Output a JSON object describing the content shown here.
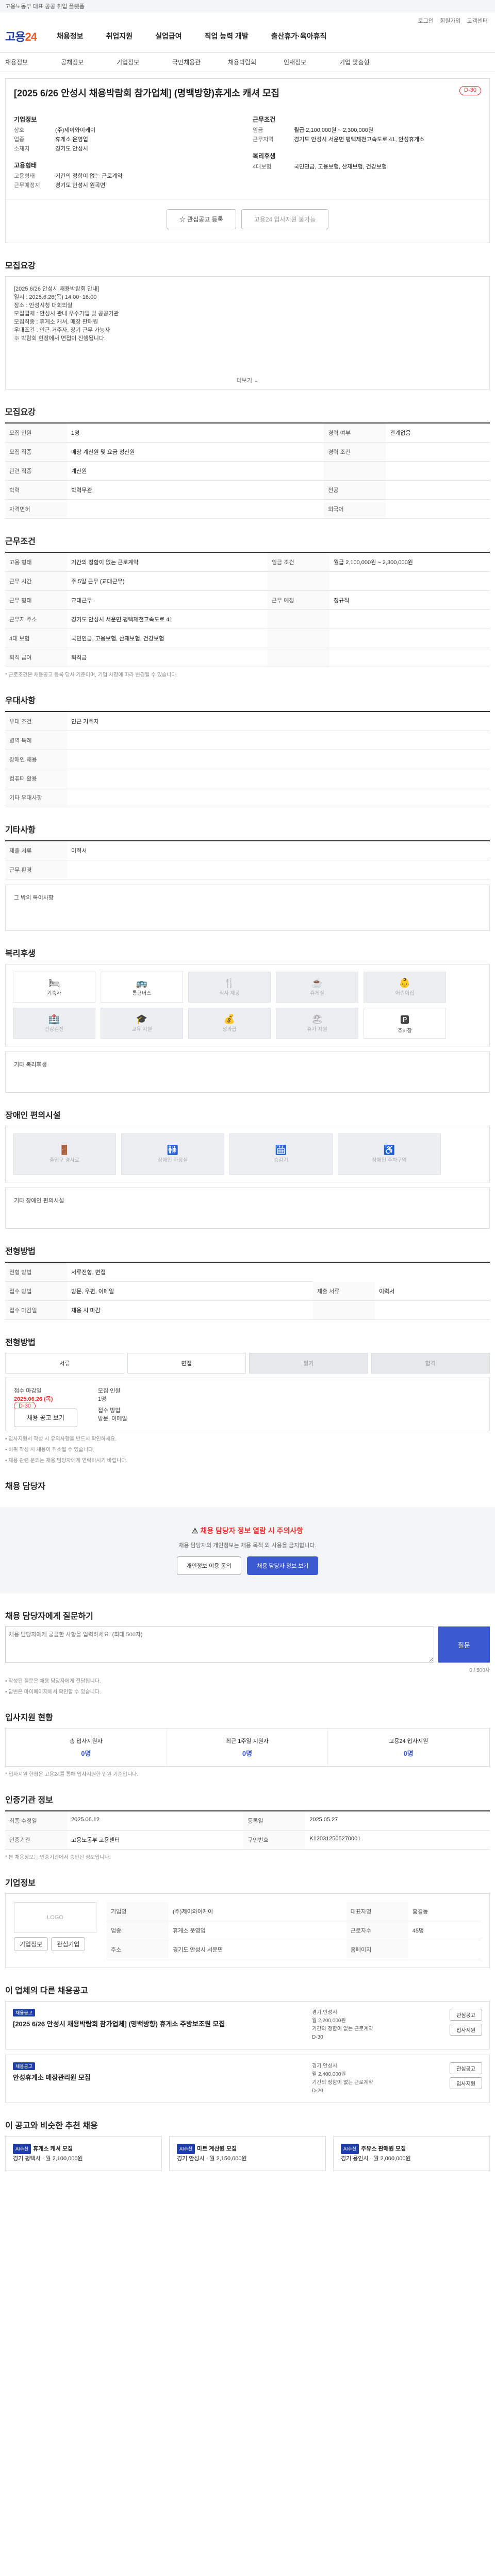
{
  "topbar": {
    "text": "고용노동부 대표 공공 취업 플랫폼"
  },
  "util": [
    "로그인",
    "회원가입",
    "고객센터"
  ],
  "logo": {
    "main": "고용",
    "accent": "24"
  },
  "nav": [
    "채용정보",
    "취업지원",
    "실업급여",
    "직업 능력 개발",
    "출산휴가·육아휴직"
  ],
  "subnav": [
    "채용정보",
    "공채정보",
    "기업정보",
    "국민채용관",
    "채용박람회",
    "인재정보",
    "기업 맞춤형"
  ],
  "job": {
    "title": "[2025 6/26 안성시 채용박람회 참가업체] (명백방향)휴게소 캐셔 모집",
    "badge": "D-30",
    "left_label": "기업정보",
    "company_k": "상호",
    "company_v": "(주)제이와이케이",
    "staff_k": "업종",
    "staff_v": "휴게소 운영업",
    "rep_k": "소재지",
    "rep_v": "경기도 안성시",
    "cond_label": "고용형태",
    "cond_k1": "고용형태",
    "cond_v1": "기간의 정함이 없는 근로계약",
    "cond_k2": "근무예정지",
    "cond_v2": "경기도 안성시 원곡면",
    "right_label": "근무조건",
    "pay_k": "임금",
    "pay_v": "월급 2,100,000원 ~ 2,300,000원",
    "loc_k": "근무지역",
    "loc_v": "경기도 안성시 서운면 평택제천고속도로 41, 안성휴게소",
    "edu_label": "복리후생",
    "edu_k": "4대보험",
    "edu_v": "국민연금, 고용보험, 산재보험, 건강보험",
    "btn_apply": "관심공고 등록",
    "btn_share": "고용24 입사지원 불가능"
  },
  "sections": {
    "desc": "모집요강",
    "recruit": "모집요강",
    "work": "근무조건",
    "prefer": "우대사항",
    "other": "기타사항",
    "welfare": "복리후생",
    "disabled": "장애인 편의시설",
    "method": "전형방법",
    "contact": "채용 담당자",
    "qa": "채용 담당자에게 질문하기",
    "stat": "입사지원 현황",
    "log": "인증기관 정보",
    "company": "기업정보",
    "others": "이 업체의 다른 채용공고",
    "ai": "이 공고와 비슷한 추천 채용"
  },
  "desc_text": [
    "[2025 6/26 안성시 채용박람회 안내]",
    "일시 : 2025.6.26(목) 14:00~16:00",
    "장소 : 안성시청 대회의실",
    "모집업체 : 안성시 관내 우수기업 및 공공기관",
    "모집직종 : 휴게소 캐셔, 매장 판매원",
    "우대조건 : 인근 거주자, 장기 근무 가능자",
    "※ 박람회 현장에서 면접이 진행됩니다."
  ],
  "more": "더보기",
  "recruit_rows": [
    {
      "k": "모집 인원",
      "v": "1명",
      "k2": "경력 여부",
      "v2": "관계없음"
    },
    {
      "k": "모집 직종",
      "v": "매장 계산원 및 요금 정산원",
      "k2": "경력 조건",
      "v2": ""
    },
    {
      "k": "관련 직종",
      "v": "계산원",
      "k2": "",
      "v2": ""
    },
    {
      "k": "학력",
      "v": "학력무관",
      "k2": "전공",
      "v2": ""
    },
    {
      "k": "자격면허",
      "v": "",
      "k2": "외국어",
      "v2": ""
    }
  ],
  "work_rows": [
    {
      "k": "고용 형태",
      "v": "기간의 정함이 없는 근로계약",
      "k2": "임금 조건",
      "v2": "월급 2,100,000원 ~ 2,300,000원"
    },
    {
      "k": "근무 시간",
      "v": "주 5일 근무 (교대근무)",
      "k2": "",
      "v2": ""
    },
    {
      "k": "근무 형태",
      "v": "교대근무",
      "k2": "근무 예정",
      "v2": "정규직"
    },
    {
      "k": "근무지 주소",
      "v": "경기도 안성시 서운면 평택제천고속도로 41",
      "k2": "",
      "v2": ""
    },
    {
      "k": "4대 보험",
      "v": "국민연금, 고용보험, 산재보험, 건강보험",
      "k2": "",
      "v2": ""
    },
    {
      "k": "퇴직 급여",
      "v": "퇴직금",
      "k2": "",
      "v2": ""
    }
  ],
  "work_note": "* 근로조건은 채용공고 등록 당시 기준이며, 기업 사정에 따라 변경될 수 있습니다.",
  "prefer_rows": [
    {
      "k": "우대 조건",
      "v": "인근 거주자"
    },
    {
      "k": "병역 특례",
      "v": ""
    },
    {
      "k": "장애인 채용",
      "v": ""
    },
    {
      "k": "컴퓨터 활용",
      "v": ""
    },
    {
      "k": "기타 우대사항",
      "v": ""
    }
  ],
  "other_rows": [
    {
      "k": "제출 서류",
      "v": "이력서"
    },
    {
      "k": "근무 환경",
      "v": ""
    }
  ],
  "other_text": "그 밖의 특이사항",
  "welfare": [
    {
      "icon": "🛏",
      "label": "기숙사",
      "on": true
    },
    {
      "icon": "🚌",
      "label": "통근버스",
      "on": true
    },
    {
      "icon": "🍴",
      "label": "식사 제공",
      "on": false
    },
    {
      "icon": "☕",
      "label": "휴게실",
      "on": false
    },
    {
      "icon": "👶",
      "label": "어린이집",
      "on": false
    },
    {
      "icon": "🏥",
      "label": "건강검진",
      "on": false
    },
    {
      "icon": "🎓",
      "label": "교육 지원",
      "on": false
    },
    {
      "icon": "💰",
      "label": "성과급",
      "on": false
    },
    {
      "icon": "🏖",
      "label": "휴가 지원",
      "on": false
    },
    {
      "icon": "🅿",
      "label": "주차장",
      "on": true
    }
  ],
  "welfare_note": "기타 복리후생",
  "disabled": [
    {
      "icon": "🚪",
      "label": "출입구 경사로"
    },
    {
      "icon": "🚻",
      "label": "장애인 화장실"
    },
    {
      "icon": "🛗",
      "label": "승강기"
    },
    {
      "icon": "♿",
      "label": "장애인 주차구역"
    }
  ],
  "disabled_note": "기타 장애인 편의시설",
  "method_rows": [
    {
      "k": "전형 방법",
      "v": "서류전형, 면접"
    },
    {
      "k": "접수 방법",
      "v": "방문, 우편, 이메일",
      "k2": "제출 서류",
      "v2": "이력서"
    },
    {
      "k": "접수 마감일",
      "v": "채용 시 마감",
      "k2": "",
      "v2": ""
    }
  ],
  "steps": [
    {
      "label": "서류",
      "on": true
    },
    {
      "label": "면접",
      "on": true
    },
    {
      "label": "필기",
      "on": false
    },
    {
      "label": "합격",
      "on": false
    }
  ],
  "apply": {
    "k1": "접수 마감일",
    "v1": "2025.06.26 (목)",
    "k2": "모집 인원",
    "v2": "1명",
    "k3": "접수 방법",
    "v3": "방문, 이메일",
    "badge": "D-30",
    "btn": "채용 공고 보기"
  },
  "apply_notes": [
    "• 입사지원서 작성 시 유의사항을 반드시 확인하세요.",
    "• 허위 작성 시 채용이 취소될 수 있습니다.",
    "• 채용 관련 문의는 채용 담당자에게 연락하시기 바랍니다."
  ],
  "cta": {
    "title": "채용 담당자 정보 열람 시 주의사항",
    "s1": "채용 담당자의 개인정보는 채용 목적 외 사용을 금지합니다.",
    "b1": "개인정보 이용 동의",
    "b2": "채용 담당자 정보 보기"
  },
  "qa": {
    "placeholder": "채용 담당자에게 궁금한 사항을 입력하세요. (최대 500자)",
    "send": "질문",
    "count": "0 / 500자",
    "notes": [
      "• 작성된 질문은 채용 담당자에게 전달됩니다.",
      "• 답변은 마이페이지에서 확인할 수 있습니다."
    ]
  },
  "stat": [
    {
      "k": "총 입사지원자",
      "v": "0명"
    },
    {
      "k": "최근 1주일 지원자",
      "v": "0명"
    },
    {
      "k": "고용24 입사지원",
      "v": "0명"
    }
  ],
  "stat_note": "* 입사지원 현황은 고용24를 통해 입사지원한 인원 기준입니다.",
  "log_rows": [
    {
      "k": "최종 수정일",
      "v": "2025.06.12",
      "k2": "등록일",
      "v2": "2025.05.27"
    },
    {
      "k": "인증기관",
      "v": "고용노동부 고용센터",
      "k2": "구인번호",
      "v2": "K120312505270001"
    }
  ],
  "log_note": "* 본 채용정보는 인증기관에서 승인된 정보입니다.",
  "company_info": {
    "logo": "LOGO",
    "btn1": "기업정보",
    "btn2": "관심기업",
    "rows": [
      {
        "k": "기업명",
        "v": "(주)제이와이케이",
        "k2": "대표자명",
        "v2": "홍길동"
      },
      {
        "k": "업종",
        "v": "휴게소 운영업",
        "k2": "근로자수",
        "v2": "45명"
      },
      {
        "k": "주소",
        "v": "경기도 안성시 서운면",
        "k2": "홈페이지",
        "v2": ""
      }
    ]
  },
  "others": [
    {
      "tag": "채용공고",
      "title": "[2025 6/26 안성시 채용박람회 참가업체] (명백방향) 휴게소 주방보조원 모집",
      "m1": "경기 안성시",
      "m2": "월 2,200,000원",
      "m3": "기간의 정함이 없는 근로계약",
      "d": "D-30",
      "b1": "관심공고",
      "b2": "입사지원"
    },
    {
      "tag": "채용공고",
      "title": "안성휴게소 매장관리원 모집",
      "m1": "경기 안성시",
      "m2": "월 2,400,000원",
      "m3": "기간의 정함이 없는 근로계약",
      "d": "D-20",
      "b1": "관심공고",
      "b2": "입사지원"
    }
  ],
  "ai": [
    {
      "tag": "AI추천",
      "title": "휴게소 캐셔 모집",
      "s": "경기 평택시 · 월 2,100,000원"
    },
    {
      "tag": "AI추천",
      "title": "마트 계산원 모집",
      "s": "경기 안성시 · 월 2,150,000원"
    },
    {
      "tag": "AI추천",
      "title": "주유소 판매원 모집",
      "s": "경기 용인시 · 월 2,000,000원"
    }
  ]
}
